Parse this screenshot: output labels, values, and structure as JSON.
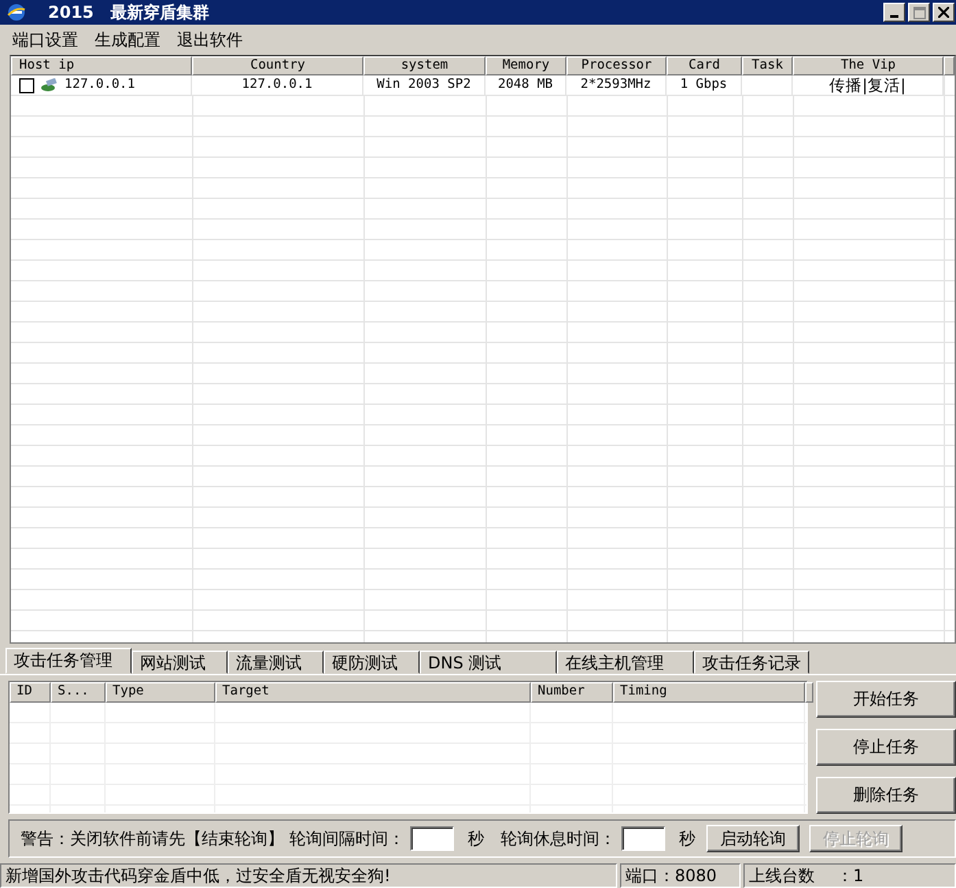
{
  "window": {
    "year": "2015",
    "title": "最新穿盾集群"
  },
  "menu": [
    "端口设置",
    "生成配置",
    "退出软件"
  ],
  "hosts": {
    "columns": [
      "Host ip",
      "Country",
      "system",
      "Memory",
      "Processor",
      "Card",
      "Task",
      "The Vip"
    ],
    "rows": [
      {
        "checked": false,
        "cells": [
          "127.0.0.1",
          "127.0.0.1",
          "Win 2003 SP2",
          "2048 MB",
          "2*2593MHz",
          "1 Gbps",
          "",
          "传播|复活|"
        ]
      }
    ]
  },
  "tabs": [
    {
      "label": "攻击任务管理",
      "selected": true
    },
    {
      "label": "网站测试",
      "selected": false
    },
    {
      "label": "流量测试",
      "selected": false
    },
    {
      "label": "硬防测试",
      "selected": false
    },
    {
      "label": "DNS 测试",
      "selected": false
    },
    {
      "label": "在线主机管理",
      "selected": false
    },
    {
      "label": "攻击任务记录",
      "selected": false
    }
  ],
  "tasks": {
    "columns": [
      "ID",
      "S...",
      "Type",
      "Target",
      "Number",
      "Timing"
    ]
  },
  "task_buttons": [
    {
      "label": "开始任务"
    },
    {
      "label": "停止任务"
    },
    {
      "label": "删除任务"
    }
  ],
  "poll_bar": {
    "warning": "警告：关闭软件前请先【结束轮询】",
    "interval_label": "轮询间隔时间：",
    "interval_unit": "秒",
    "rest_label": "轮询休息时间：",
    "rest_unit": "秒",
    "buttons": [
      {
        "label": "启动轮询",
        "disabled": false
      },
      {
        "label": "停止轮询",
        "disabled": true
      }
    ]
  },
  "status_bar": {
    "message": "新增国外攻击代码穿金盾中低，过安全盾无视安全狗!",
    "port": "端口：8080",
    "online_label": "上线台数",
    "online_count": "：1"
  }
}
